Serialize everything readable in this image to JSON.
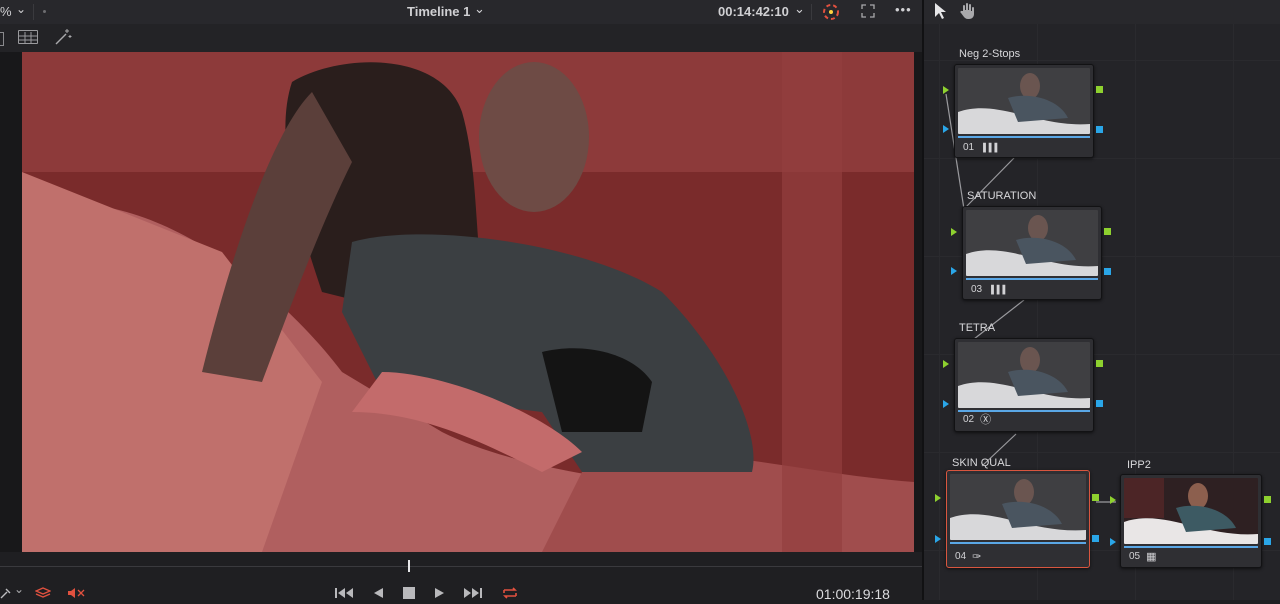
{
  "topbar": {
    "zoom_fragment": "%",
    "timeline_title": "Timeline 1",
    "timecode": "00:14:42:10",
    "more": "•••"
  },
  "transport": {
    "timecode": "01:00:19:18"
  },
  "nodes": [
    {
      "label": "Neg 2-Stops",
      "number": "01",
      "icon_name": "bars-icon",
      "icon_glyph": "▐▐▐"
    },
    {
      "label": "SATURATION",
      "number": "03",
      "icon_name": "bars-icon",
      "icon_glyph": "▐▐▐"
    },
    {
      "label": "TETRA",
      "number": "02",
      "icon_name": "ofx-plugin-icon",
      "icon_glyph": "Ⓧ"
    },
    {
      "label": "SKIN QUAL",
      "number": "04",
      "icon_name": "eyedropper-icon",
      "icon_glyph": "✑"
    },
    {
      "label": "IPP2",
      "number": "05",
      "icon_name": "grid-icon",
      "icon_glyph": "▦"
    }
  ],
  "colors": {
    "accent_selected": "#d9563f",
    "link_green": "#8ed12f",
    "link_blue": "#2aa6e8",
    "loop_red": "#e2513f"
  }
}
